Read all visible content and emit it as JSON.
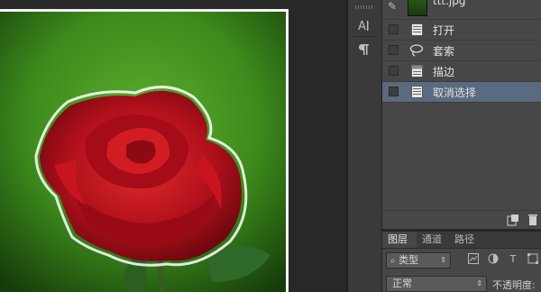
{
  "history": {
    "file_name": "ttt.jpg",
    "items": [
      {
        "label": "打开",
        "icon": "document-icon",
        "selected": false
      },
      {
        "label": "套索",
        "icon": "lasso-icon",
        "selected": false
      },
      {
        "label": "描边",
        "icon": "stroke-icon",
        "selected": false
      },
      {
        "label": "取消选择",
        "icon": "document-icon",
        "selected": true
      }
    ]
  },
  "layers": {
    "tabs": [
      "图层",
      "通道",
      "路径"
    ],
    "active_tab": "图层",
    "filter_label": "类型",
    "blend_mode": "正常",
    "opacity_label": "不透明度:"
  },
  "colors": {
    "selection_highlight": "#5a6a80",
    "panel_bg": "#474747",
    "rose_red": "#c4101c",
    "background_green": "#3d8a1f"
  }
}
